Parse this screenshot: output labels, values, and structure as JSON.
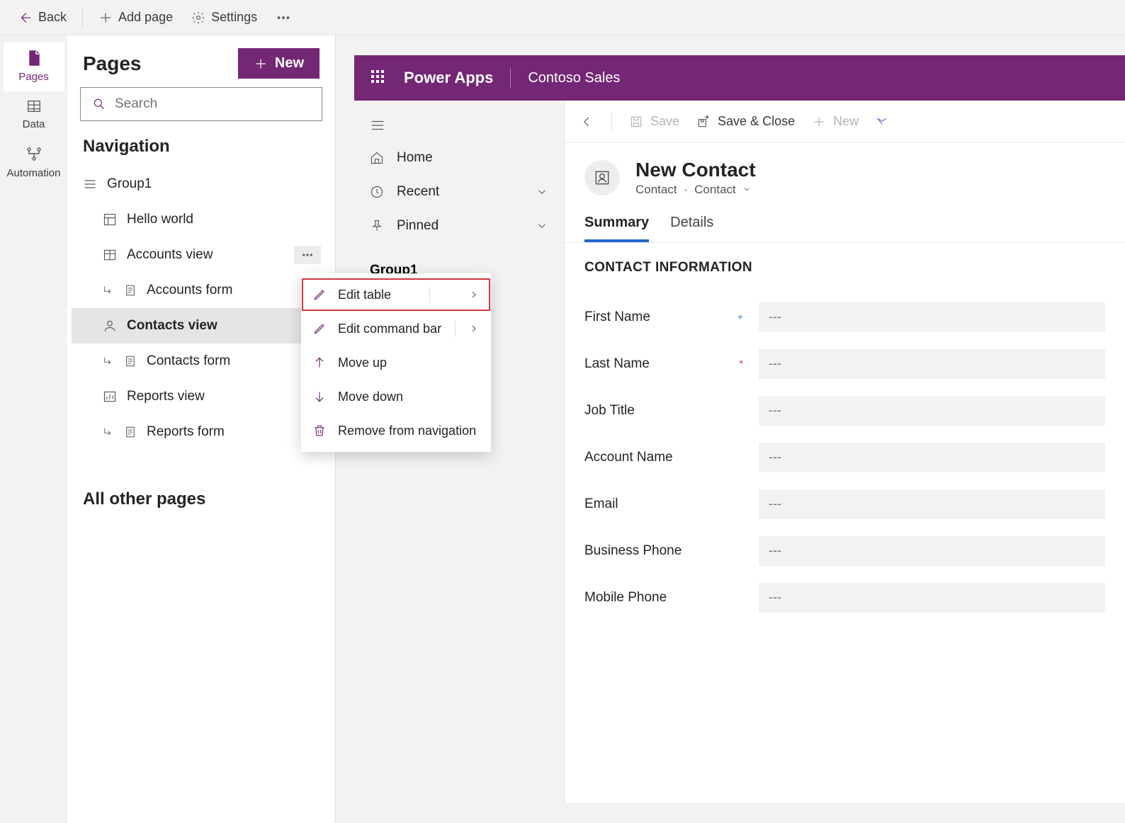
{
  "toolbar": {
    "back": "Back",
    "add_page": "Add page",
    "settings": "Settings"
  },
  "rail": {
    "pages": "Pages",
    "data": "Data",
    "automation": "Automation"
  },
  "pages_panel": {
    "title": "Pages",
    "new_button": "New",
    "search_placeholder": "Search",
    "navigation_heading": "Navigation",
    "other_pages_heading": "All other pages",
    "tree": {
      "group": "Group1",
      "items": [
        {
          "label": "Hello world",
          "icon": "dashboard"
        },
        {
          "label": "Accounts view",
          "icon": "table",
          "has_more": true
        },
        {
          "label": "Accounts form",
          "icon": "form",
          "sub": true
        },
        {
          "label": "Contacts view",
          "icon": "people",
          "selected": true
        },
        {
          "label": "Contacts form",
          "icon": "form",
          "sub": true
        },
        {
          "label": "Reports view",
          "icon": "chart"
        },
        {
          "label": "Reports form",
          "icon": "form",
          "sub": true
        }
      ]
    }
  },
  "context_menu": {
    "items": [
      {
        "label": "Edit table",
        "icon": "pencil",
        "has_sub": true,
        "highlight": true
      },
      {
        "label": "Edit command bar",
        "icon": "pencil",
        "has_sub": true
      },
      {
        "label": "Move up",
        "icon": "arrow-up"
      },
      {
        "label": "Move down",
        "icon": "arrow-down"
      },
      {
        "label": "Remove from navigation",
        "icon": "trash"
      }
    ]
  },
  "app_header": {
    "brand": "Power Apps",
    "app_name": "Contoso Sales"
  },
  "sitemap": {
    "items": [
      {
        "label": "Home",
        "icon": "home"
      },
      {
        "label": "Recent",
        "icon": "clock",
        "expandable": true
      },
      {
        "label": "Pinned",
        "icon": "pin",
        "expandable": true
      }
    ],
    "group_label": "Group1"
  },
  "commandbar": {
    "save": "Save",
    "save_close": "Save & Close",
    "new": "New"
  },
  "record": {
    "title": "New Contact",
    "entity": "Contact",
    "form_name": "Contact"
  },
  "tabs": {
    "summary": "Summary",
    "details": "Details"
  },
  "form": {
    "section_title": "CONTACT INFORMATION",
    "placeholder": "---",
    "fields": [
      {
        "label": "First Name",
        "mark": "rec"
      },
      {
        "label": "Last Name",
        "mark": "req"
      },
      {
        "label": "Job Title"
      },
      {
        "label": "Account Name"
      },
      {
        "label": "Email"
      },
      {
        "label": "Business Phone"
      },
      {
        "label": "Mobile Phone"
      }
    ]
  }
}
